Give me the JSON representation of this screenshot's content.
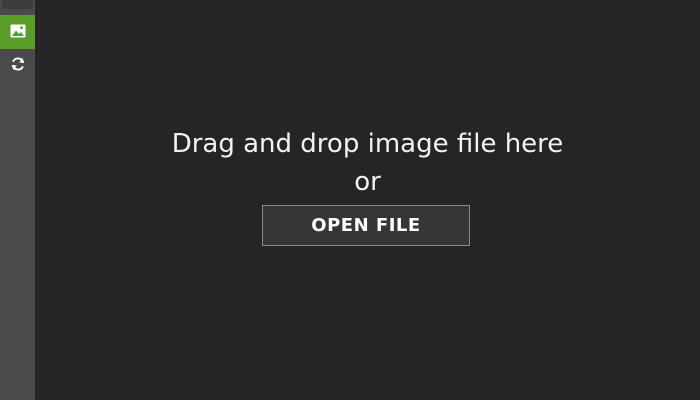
{
  "theme": {
    "background": "#252525",
    "sidebar_background": "#4a4a4a",
    "accent": "#5a9e2a",
    "text": "#f2f2f2",
    "button_border": "#8a8a8a"
  },
  "sidebar": {
    "items": [
      {
        "icon": "image-icon",
        "active": true
      },
      {
        "icon": "refresh-icon",
        "active": false
      }
    ]
  },
  "drop_zone": {
    "line1": "Drag and drop image file here",
    "line2": "or",
    "open_button_label": "OPEN FILE"
  }
}
